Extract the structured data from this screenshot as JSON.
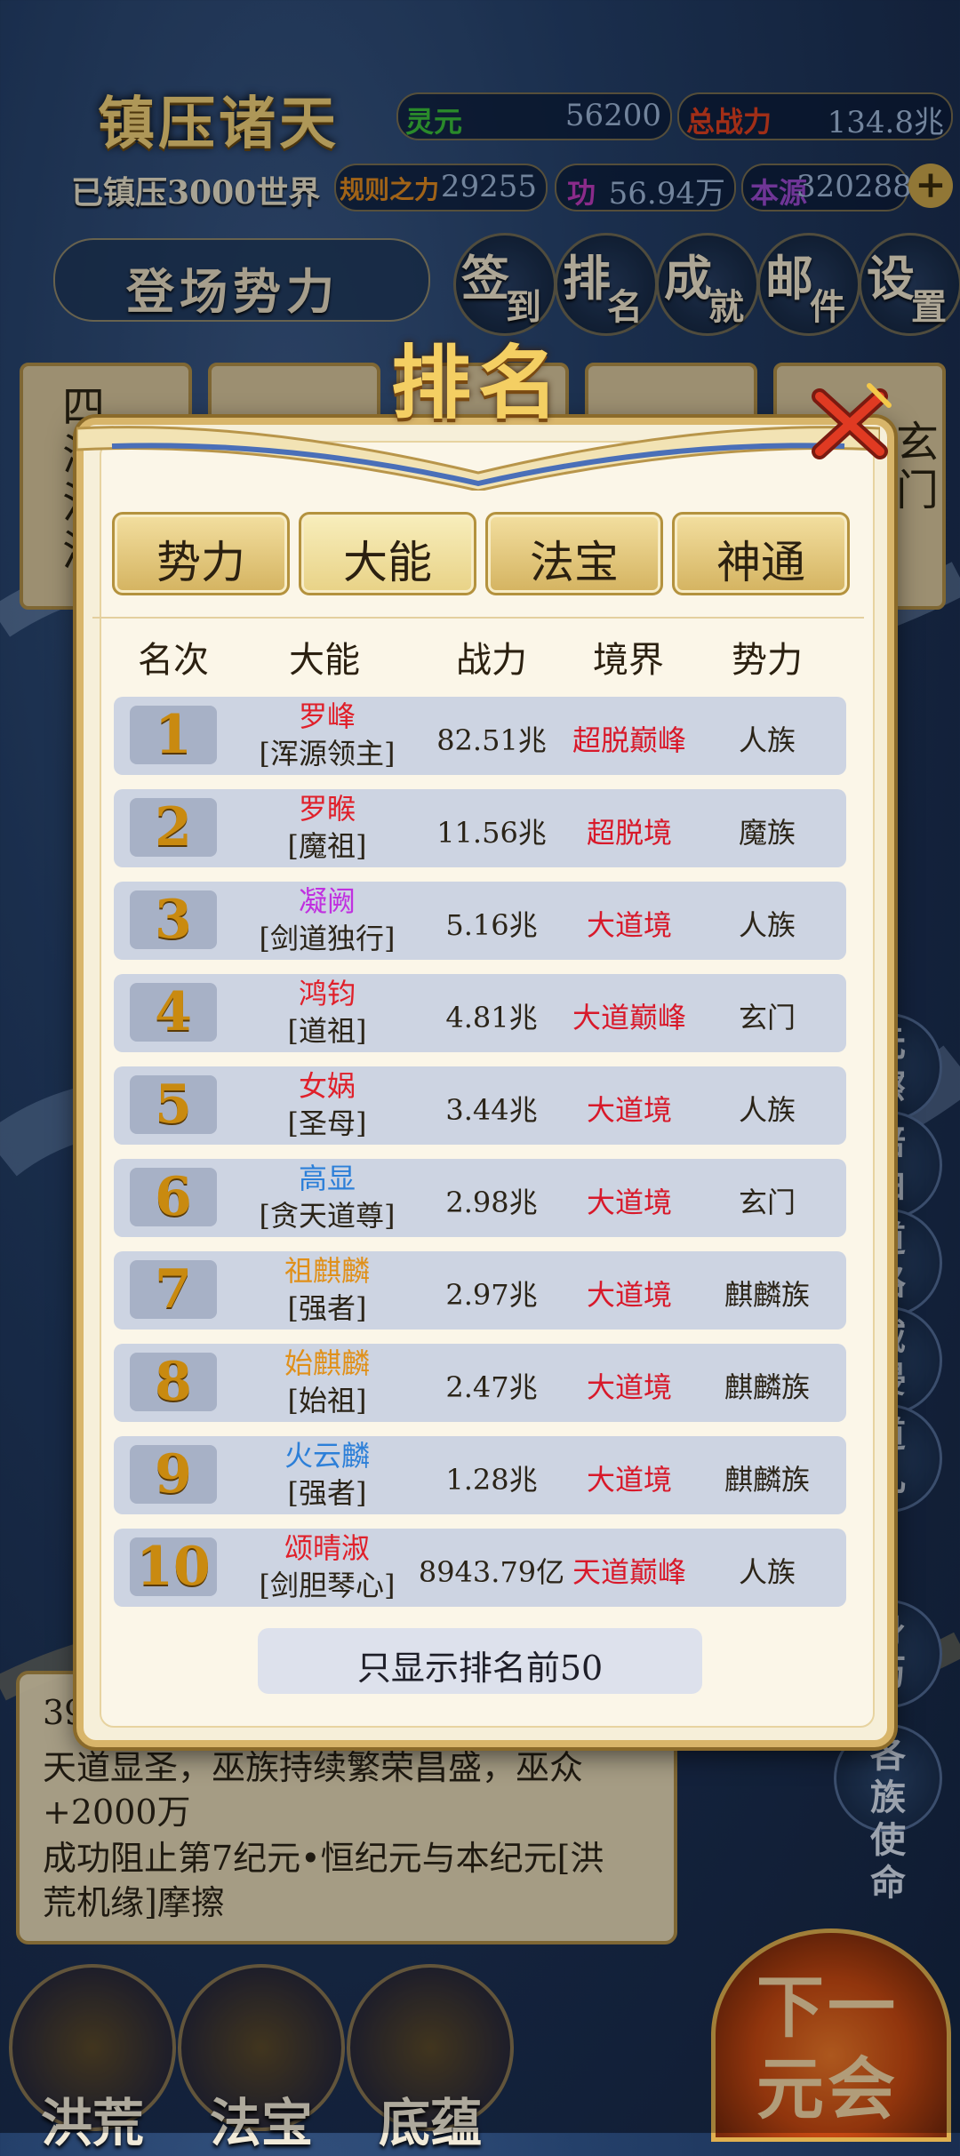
{
  "header": {
    "game_title": "镇压诸天",
    "world_status": "已镇压3000世界",
    "stats": [
      {
        "label": "灵元",
        "value": "56200",
        "label_color": "#3bbf3b"
      },
      {
        "label": "总战力",
        "value": "134.8兆",
        "label_color": "#e04020"
      },
      {
        "label": "规则之力",
        "value": "29255",
        "label_color": "#e08a20"
      },
      {
        "label": "功",
        "value": "56.94万",
        "label_color": "#c03cc0"
      },
      {
        "label": "本源",
        "value": "320288",
        "label_color": "#9a4ad0"
      }
    ],
    "faction_button": "登场势力",
    "menu": [
      {
        "a": "签",
        "b": "到"
      },
      {
        "a": "排",
        "b": "名"
      },
      {
        "a": "成",
        "b": "就"
      },
      {
        "a": "邮",
        "b": "件"
      },
      {
        "a": "设",
        "b": "置"
      }
    ]
  },
  "background_cards": {
    "left": "四海汪洋",
    "right": "玄门"
  },
  "side_buttons": [
    "元擦",
    "培曲",
    "道路",
    "域侵",
    "道儿",
    "身历",
    "各族使命"
  ],
  "log": {
    "partial_number": "39",
    "lines": [
      "天道显圣，巫族持续繁荣昌盛，巫众",
      "+2000万",
      "成功阻止第7纪元•恒纪元与本纪元[洪",
      "荒机缘]摩擦"
    ]
  },
  "bottom_buttons": [
    "洪荒",
    "法宝",
    "底蕴"
  ],
  "next_button": {
    "l1": "下一",
    "l2": "元会"
  },
  "ranking": {
    "title": "排名",
    "tabs": [
      "势力",
      "大能",
      "法宝",
      "神通"
    ],
    "active_tab": 1,
    "columns": [
      "名次",
      "大能",
      "战力",
      "境界",
      "势力"
    ],
    "rows": [
      {
        "rank": "1",
        "name": "罗峰",
        "name_color": "#e0202a",
        "title": "[浑源领主]",
        "power": "82.51兆",
        "realm": "超脱巅峰",
        "faction": "人族"
      },
      {
        "rank": "2",
        "name": "罗睺",
        "name_color": "#e0202a",
        "title": "[魔祖]",
        "power": "11.56兆",
        "realm": "超脱境",
        "faction": "魔族"
      },
      {
        "rank": "3",
        "name": "凝阙",
        "name_color": "#c030e0",
        "title": "[剑道独行]",
        "power": "5.16兆",
        "realm": "大道境",
        "faction": "人族"
      },
      {
        "rank": "4",
        "name": "鸿钧",
        "name_color": "#e0202a",
        "title": "[道祖]",
        "power": "4.81兆",
        "realm": "大道巅峰",
        "faction": "玄门"
      },
      {
        "rank": "5",
        "name": "女娲",
        "name_color": "#e0202a",
        "title": "[圣母]",
        "power": "3.44兆",
        "realm": "大道境",
        "faction": "人族"
      },
      {
        "rank": "6",
        "name": "高显",
        "name_color": "#2c7fd8",
        "title": "[贪天道尊]",
        "power": "2.98兆",
        "realm": "大道境",
        "faction": "玄门"
      },
      {
        "rank": "7",
        "name": "祖麒麟",
        "name_color": "#e0901a",
        "title": "[强者]",
        "power": "2.97兆",
        "realm": "大道境",
        "faction": "麒麟族"
      },
      {
        "rank": "8",
        "name": "始麒麟",
        "name_color": "#e0901a",
        "title": "[始祖]",
        "power": "2.47兆",
        "realm": "大道境",
        "faction": "麒麟族"
      },
      {
        "rank": "9",
        "name": "火云麟",
        "name_color": "#2c7fd8",
        "title": "[强者]",
        "power": "1.28兆",
        "realm": "大道境",
        "faction": "麒麟族"
      },
      {
        "rank": "10",
        "name": "颂晴淑",
        "name_color": "#e0202a",
        "title": "[剑胆琴心]",
        "power": "8943.79亿",
        "realm": "天道巅峰",
        "faction": "人族"
      }
    ],
    "footer_note": "只显示排名前50"
  }
}
